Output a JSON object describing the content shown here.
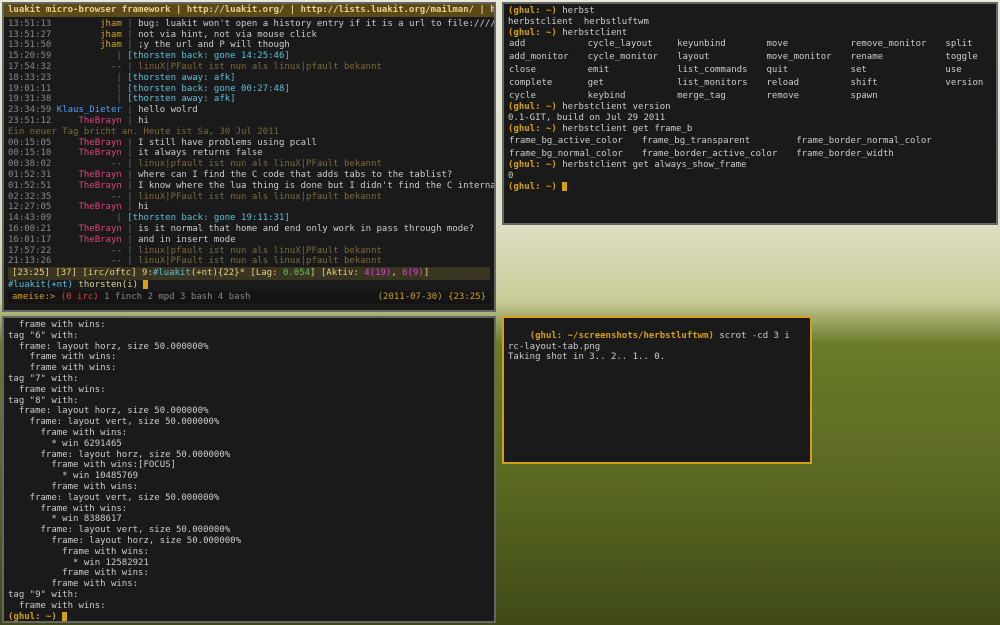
{
  "irc": {
    "titlebar": "luakit micro-browser framework | http://luakit.org/ | http://lists.luakit.org/mailman/ | http://g",
    "lines": [
      {
        "t": "13:51:13",
        "n": "jham",
        "nc": "n-jham",
        "m": "bug: luakit won't open a history entry if it is a url to file:////foo/bar"
      },
      {
        "t": "13:51:27",
        "n": "jham",
        "nc": "n-jham",
        "m": "not via hint, not via mouse click"
      },
      {
        "t": "13:51:50",
        "n": "jham",
        "nc": "n-jham",
        "m": ";y the url and P will though"
      },
      {
        "t": "15:20:59",
        "n": "",
        "nc": "",
        "m": "[thorsten back: gone 14:25:46]",
        "br": true
      },
      {
        "t": "17:54:32",
        "n": "--",
        "nc": "n-dash",
        "m": "linuX|PFault ist nun als linux|pfault bekannt",
        "sys": true
      },
      {
        "t": "18:33:23",
        "n": "",
        "nc": "",
        "m": "[thorsten away: afk]",
        "br": true
      },
      {
        "t": "19:01:11",
        "n": "",
        "nc": "",
        "m": "[thorsten back: gone 00:27:48]",
        "br": true
      },
      {
        "t": "19:31:38",
        "n": "",
        "nc": "",
        "m": "[thorsten away: afk]",
        "br": true
      },
      {
        "t": "23:34:59",
        "n": "Klaus_Dieter",
        "nc": "n-klaus",
        "m": "hello wolrd"
      },
      {
        "t": "23:51:12",
        "n": "TheBrayn",
        "nc": "n-brayn",
        "m": "hi"
      }
    ],
    "daybreak": "Ein neuer Tag bricht an. Heute ist Sa, 30 Jul 2011",
    "lines2": [
      {
        "t": "00:15:05",
        "n": "TheBrayn",
        "nc": "n-brayn",
        "m": "I still have problems using pcall"
      },
      {
        "t": "00:15:10",
        "n": "TheBrayn",
        "nc": "n-brayn",
        "m": "it always returns false"
      },
      {
        "t": "00:38:02",
        "n": "--",
        "nc": "n-dash",
        "m": "linux|pfault ist nun als linuX|PFault bekannt",
        "sys": true
      },
      {
        "t": "01:52:31",
        "n": "TheBrayn",
        "nc": "n-brayn",
        "m": "where can I find the C code that adds tabs to the tablist?"
      },
      {
        "t": "01:52:51",
        "n": "TheBrayn",
        "nc": "n-brayn",
        "m": "I know where the lua thing is done but I didn't find the C internals"
      },
      {
        "t": "02:32:35",
        "n": "--",
        "nc": "n-dash",
        "m": "linuX|PFault ist nun als linux|pfault bekannt",
        "sys": true
      },
      {
        "t": "12:27:05",
        "n": "TheBrayn",
        "nc": "n-brayn",
        "m": "hi"
      },
      {
        "t": "14:43:09",
        "n": "",
        "nc": "",
        "m": "[thorsten back: gone 19:11:31]",
        "br": true
      },
      {
        "t": "16:00:21",
        "n": "TheBrayn",
        "nc": "n-brayn",
        "m": "is it normal that home and end only work in pass through mode?"
      },
      {
        "t": "16:01:17",
        "n": "TheBrayn",
        "nc": "n-brayn",
        "m": "and in insert mode"
      },
      {
        "t": "17:57:22",
        "n": "--",
        "nc": "n-dash",
        "m": "linux|pfault ist nun als linuX|PFault bekannt",
        "sys": true
      },
      {
        "t": "21:13:26",
        "n": "--",
        "nc": "n-dash",
        "m": "linuX|PFault ist nun als linux|pfault bekannt",
        "sys": true
      }
    ],
    "status1_a": "[23:25] [37] [irc/oftc] 9:",
    "status1_b": "#luakit",
    "status1_c": "(+nt){22}* [Lag: ",
    "status1_d": "0.054",
    "status1_e": "] [Aktiv: ",
    "status1_f": "4(19)",
    "status1_g": ", ",
    "status1_h": "6(9)",
    "status1_i": "]",
    "input_chan": "#luakit(+nt) ",
    "input_nick": "thorsten(i) ",
    "status2_a": "ameise:> ",
    "status2_b": "(0 irc)",
    "status2_c": "   1 finch  2 mpd  3 bash  4 bash",
    "status2_d": "(2011-07-30) {23:25}"
  },
  "hc": {
    "prompt": "(ghul: ~)",
    "cmds": {
      "c1": "herbst",
      "r1": "herbstclient  herbstluftwm",
      "c2": "herbstclient",
      "rows": [
        [
          "add",
          "cycle_layout",
          "keyunbind",
          "move",
          "remove_monitor",
          "split"
        ],
        [
          "add_monitor",
          "cycle_monitor",
          "layout",
          "move_monitor",
          "rename",
          "toggle"
        ],
        [
          "close",
          "emit",
          "list_commands",
          "quit",
          "set",
          "use"
        ],
        [
          "complete",
          "get",
          "list_monitors",
          "reload",
          "shift",
          "version"
        ],
        [
          "cycle",
          "keybind",
          "merge_tag",
          "remove",
          "spawn",
          ""
        ]
      ],
      "c3": "herbstclient version",
      "r3": "0.1-GIT, build on Jul 29 2011",
      "c4": "herbstclient get frame_b",
      "rows2": [
        [
          "frame_bg_active_color",
          "frame_bg_transparent",
          "frame_border_normal_color"
        ],
        [
          "frame_bg_normal_color",
          "frame_border_active_color",
          "frame_border_width"
        ]
      ],
      "c5": "herbstclient get always_show_frame",
      "r5": "0"
    }
  },
  "tree": {
    "lines": [
      "  frame with wins:",
      "tag \"6\" with:",
      "  frame: layout horz, size 50.000000%",
      "    frame with wins:",
      "    frame with wins:",
      "tag \"7\" with:",
      "  frame with wins:",
      "tag \"8\" with:",
      "  frame: layout horz, size 50.000000%",
      "    frame: layout vert, size 50.000000%",
      "      frame with wins:",
      "        * win 6291465",
      "      frame: layout horz, size 50.000000%",
      "        frame with wins:[FOCUS]",
      "          * win 10485769",
      "        frame with wins:",
      "    frame: layout vert, size 50.000000%",
      "      frame with wins:",
      "        * win 8388617",
      "      frame: layout vert, size 50.000000%",
      "        frame: layout horz, size 50.000000%",
      "          frame with wins:",
      "            * win 12582921",
      "          frame with wins:",
      "        frame with wins:",
      "tag \"9\" with:",
      "  frame with wins:"
    ],
    "prompt": "(ghul: ~)"
  },
  "scrot": {
    "prompt": "(ghul: ~/screenshots/herbstluftwm)",
    "cmd": "scrot -cd 3 i",
    "l1": "rc-layout-tab.png",
    "l2": "Taking shot in 3.. 2.. 1.. 0."
  }
}
